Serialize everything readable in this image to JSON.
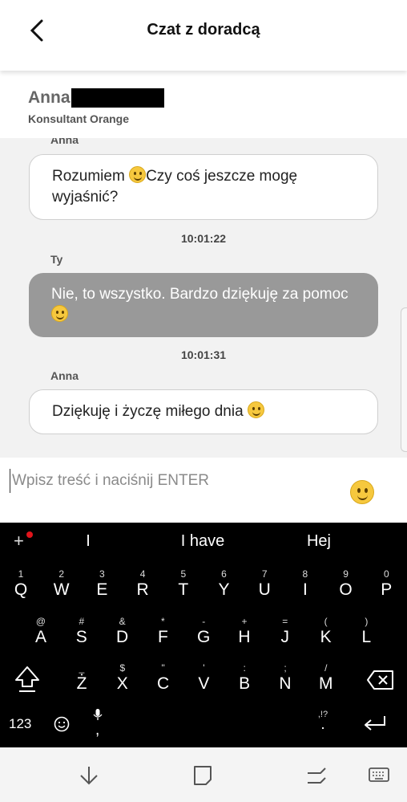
{
  "header": {
    "title": "Czat z doradcą"
  },
  "agent": {
    "name": "Anna",
    "role": "Konsultant Orange"
  },
  "messages": [
    {
      "sender": "Anna",
      "text": "Rozumiem ",
      "text2": "Czy coś jeszcze mogę wyjaśnić?"
    },
    {
      "time": "10:01:22"
    },
    {
      "sender": "Ty",
      "text": "Nie, to wszystko. Bardzo dziękuję za pomoc "
    },
    {
      "time": "10:01:31"
    },
    {
      "sender": "Anna",
      "text": "Dziękuję i życzę miłego dnia "
    }
  ],
  "input": {
    "placeholder": "Wpisz treść i naciśnij ENTER"
  },
  "keyboard": {
    "suggestions": [
      "I",
      "I have",
      "Hej"
    ],
    "row1": [
      [
        "1",
        "Q"
      ],
      [
        "2",
        "W"
      ],
      [
        "3",
        "E"
      ],
      [
        "4",
        "R"
      ],
      [
        "5",
        "T"
      ],
      [
        "6",
        "Y"
      ],
      [
        "7",
        "U"
      ],
      [
        "8",
        "I"
      ],
      [
        "9",
        "O"
      ],
      [
        "0",
        "P"
      ]
    ],
    "row2": [
      [
        "@",
        "A"
      ],
      [
        "#",
        "S"
      ],
      [
        "&",
        "D"
      ],
      [
        "*",
        "F"
      ],
      [
        "-",
        "G"
      ],
      [
        "+",
        "H"
      ],
      [
        "=",
        "J"
      ],
      [
        "(",
        "K"
      ],
      [
        ")",
        "L"
      ]
    ],
    "row3": [
      [
        "_",
        "Ż"
      ],
      [
        "$",
        "X"
      ],
      [
        "\"",
        "C"
      ],
      [
        "'",
        "V"
      ],
      [
        ":",
        "B"
      ],
      [
        ";",
        "N"
      ],
      [
        "/",
        "M"
      ]
    ],
    "numbers_label": "123",
    "comma": ",",
    "period_sub": ",!?",
    "period": "."
  },
  "icons": {
    "back": "chevron-left-icon",
    "emoji": "smiley-face-icon",
    "shift": "shift-arrow-icon",
    "backspace": "backspace-icon",
    "enter": "enter-return-icon",
    "mic": "microphone-icon",
    "nav_back": "nav-back-icon",
    "nav_home": "nav-home-icon",
    "nav_recent": "nav-recent-icon",
    "nav_keyboard": "nav-keyboard-icon"
  },
  "colors": {
    "outgoing_bubble": "#999999",
    "keyboard_bg": "#000000",
    "notification_dot": "#e0141b"
  }
}
